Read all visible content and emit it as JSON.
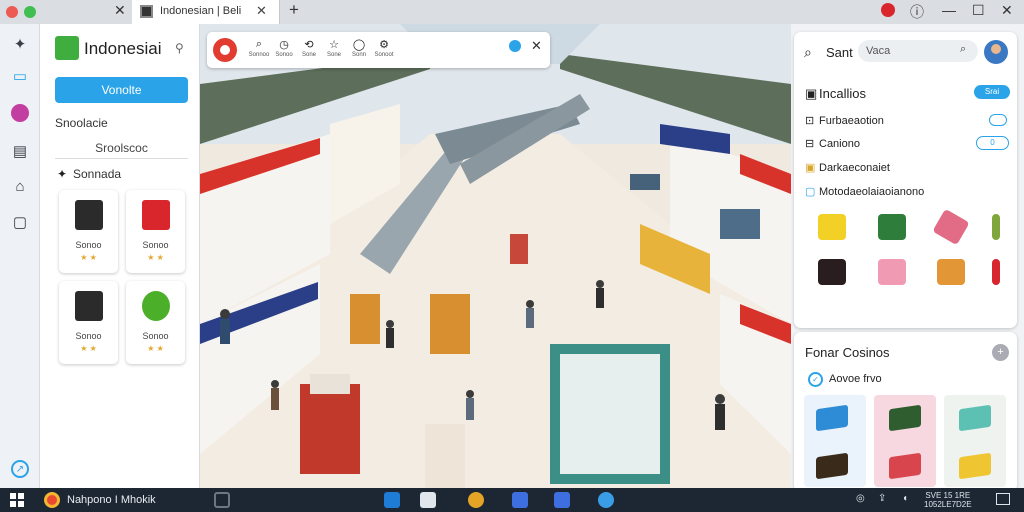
{
  "browser": {
    "active_tab_title": "Indonesian | Beli"
  },
  "app": {
    "brand_name": "Indonesiai",
    "primary_button": "Vonolte",
    "section_label": "Snoolacie",
    "sub_input_value": "Sroolscoc",
    "category_label": "Sonnada",
    "cards": [
      {
        "label": "Sonoo",
        "icon": "black-box",
        "color": "#2b2b2b"
      },
      {
        "label": "Sonoo",
        "icon": "red-bag",
        "color": "#d9262c"
      },
      {
        "label": "Sonoo",
        "icon": "black-box",
        "color": "#2b2b2b"
      },
      {
        "label": "Sonoo",
        "icon": "green-plant",
        "color": "#4caf2a"
      }
    ]
  },
  "toolbar": {
    "tools": [
      {
        "icon": "search-icon",
        "glyph": "⌕",
        "label": "Sonnoo"
      },
      {
        "icon": "clock-icon",
        "glyph": "◷",
        "label": "Sonoo"
      },
      {
        "icon": "share-icon",
        "glyph": "⟲",
        "label": "Sone"
      },
      {
        "icon": "star-icon",
        "glyph": "☆",
        "label": "Sone"
      },
      {
        "icon": "circle-icon",
        "glyph": "◯",
        "label": "Sonn"
      },
      {
        "icon": "settings-icon",
        "glyph": "⚙",
        "label": "Sonoot"
      }
    ]
  },
  "right_panel": {
    "search_label": "Sant",
    "search_value": "Vaca",
    "title": "Incallios",
    "title_pill": "Srai",
    "rows": [
      {
        "icon": "link-icon",
        "glyph": "⊡",
        "text": "Furbaeaotion"
      },
      {
        "icon": "clipboard-icon",
        "glyph": "⊟",
        "text": "Caniono"
      },
      {
        "icon": "package-icon",
        "glyph": "▣",
        "text": "Darkaeconaiet"
      },
      {
        "icon": "square-icon",
        "glyph": "▢",
        "text": "Motodaeolaiaoianono"
      }
    ],
    "toggle2_label": "0",
    "items_row1": [
      {
        "icon": "yellow-box-icon",
        "color": "#f2d026"
      },
      {
        "icon": "green-chest-icon",
        "color": "#2f7d3a"
      },
      {
        "icon": "pink-wallet-icon",
        "color": "#e26b85"
      },
      {
        "icon": "green-key-icon",
        "color": "#7fa63a"
      }
    ],
    "items_row2": [
      {
        "icon": "dark-bag-icon",
        "color": "#2a1d20"
      },
      {
        "icon": "pink-box-icon",
        "color": "#f09ab4"
      },
      {
        "icon": "orange-box-icon",
        "color": "#e29636"
      },
      {
        "icon": "red-key-icon",
        "color": "#d7262d"
      }
    ],
    "bottom": {
      "title": "Fonar Cosinos",
      "plus": "+",
      "sub": "Aovoe frvo",
      "tiles": [
        {
          "icon": "blue-book-icon",
          "bg": "#eaf2fb",
          "box": "#2e8bd6"
        },
        {
          "icon": "green-box-icon",
          "bg": "#f7d8e0",
          "box": "#2f5d2f"
        },
        {
          "icon": "teal-box-icon",
          "bg": "#eef3f0",
          "box": "#5cc0b3"
        },
        {
          "icon": "brown-box-icon",
          "bg": "#eaf2fb",
          "box": "#3a2a1a"
        },
        {
          "icon": "red-box-icon",
          "bg": "#f7d8e0",
          "box": "#d8454d"
        },
        {
          "icon": "yellow-box-icon",
          "bg": "#eef3f0",
          "box": "#efc532"
        }
      ]
    }
  },
  "taskbar": {
    "app_label": "Nahpono I Mhokik",
    "tray_line1": "SVE 15 1RE",
    "tray_line2": "1052LE7D2E",
    "pinned": [
      {
        "icon": "monitor-icon",
        "color": "#6d7683"
      },
      {
        "icon": "store-icon",
        "color": "#1e7cd6"
      },
      {
        "icon": "mail-icon",
        "color": "#e1e6ec"
      },
      {
        "icon": "chrome-icon",
        "color": "#e4a526"
      },
      {
        "icon": "phone-icon",
        "color": "#3d6fe0"
      },
      {
        "icon": "edit-icon",
        "color": "#3d6fe0"
      },
      {
        "icon": "globe-icon",
        "color": "#3a9ee6"
      }
    ]
  }
}
